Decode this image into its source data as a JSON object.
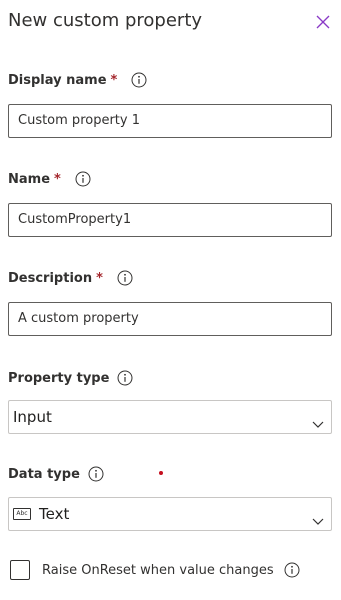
{
  "header": {
    "title": "New custom property"
  },
  "fields": {
    "display_name": {
      "label": "Display name",
      "required_mark": "*",
      "value": "Custom property 1"
    },
    "name": {
      "label": "Name",
      "required_mark": "*",
      "value": "CustomProperty1"
    },
    "description": {
      "label": "Description",
      "required_mark": "*",
      "value": "A custom property"
    },
    "property_type": {
      "label": "Property type",
      "selected": "Input"
    },
    "data_type": {
      "label": "Data type",
      "selected": "Text",
      "selected_icon": "Abc"
    }
  },
  "options": {
    "raise_onreset_label": "Raise OnReset when value changes",
    "raise_onreset_checked": false
  },
  "colors": {
    "required": "#a4262c",
    "close_icon": "#8a3ac7",
    "border": "#605e5c"
  }
}
